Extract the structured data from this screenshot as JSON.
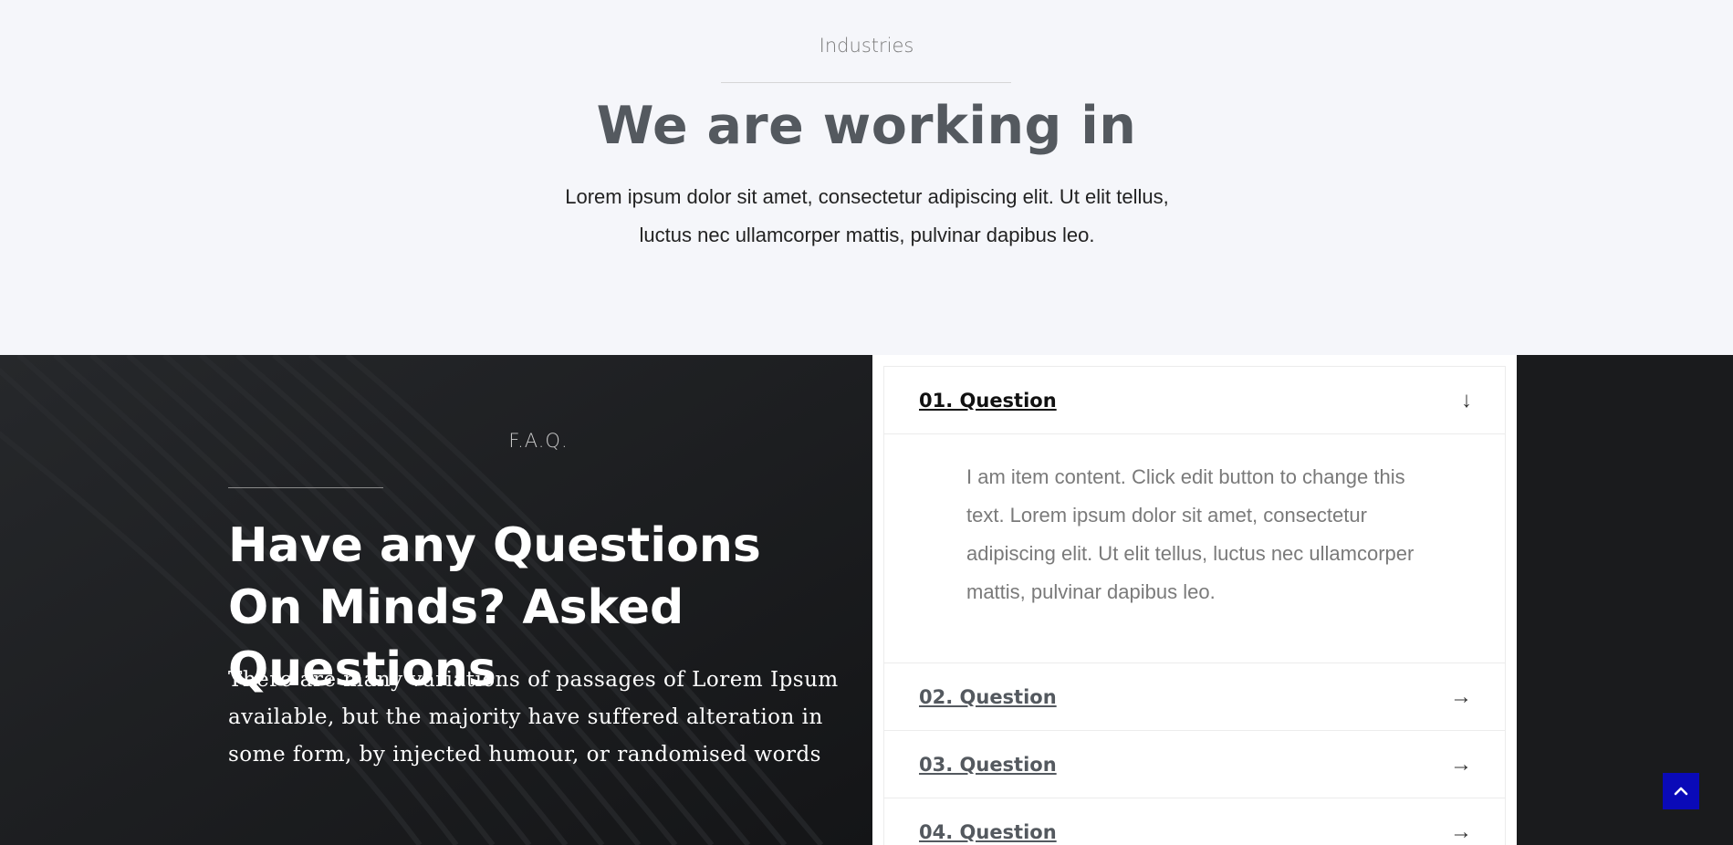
{
  "industries": {
    "subtitle": "Industries",
    "title": "We are working in",
    "text": "Lorem ipsum dolor sit amet, consectetur adipiscing elit. Ut elit tellus, luctus nec ullamcorper mattis, pulvinar dapibus leo."
  },
  "faq": {
    "label": "F.A.Q.",
    "title": "Have any Questions On Minds? Asked Questions",
    "text": "There are many variations of passages of Lorem Ipsum available, but the majority have suffered alteration in some form, by injected humour, or randomised words",
    "items": [
      {
        "title": "01. Question",
        "icon": "arrow-down-icon",
        "content": "I am item content. Click edit button to change this text. Lorem ipsum dolor sit amet, consectetur adipiscing elit. Ut elit tellus, luctus nec ullamcorper mattis, pulvinar dapibus leo."
      },
      {
        "title": "02. Question",
        "icon": "arrow-right-icon"
      },
      {
        "title": "03. Question",
        "icon": "arrow-right-icon"
      },
      {
        "title": "04. Question",
        "icon": "arrow-right-icon"
      }
    ]
  },
  "colors": {
    "accent": "#0a0ab8",
    "dark_bg": "#1a1b1d",
    "light_bg": "#f5f6fa"
  },
  "back_to_top": {
    "icon": "chevron-up-icon"
  }
}
